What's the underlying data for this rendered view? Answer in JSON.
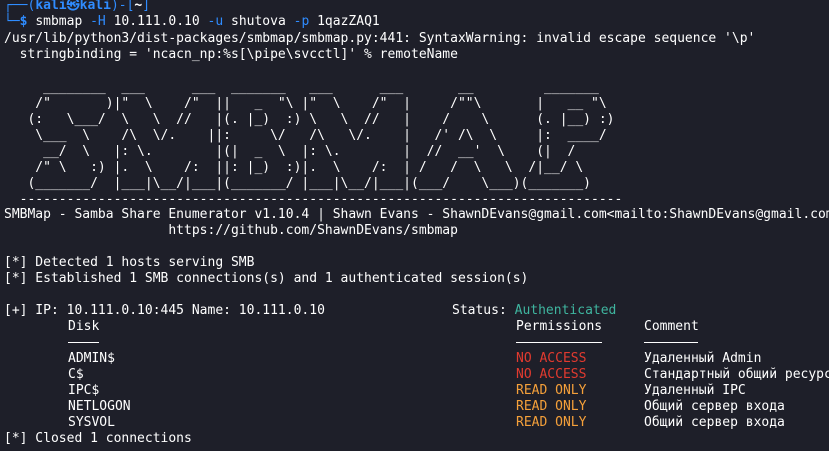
{
  "prompt": {
    "left_bracket_top": "┌──(",
    "user_host": "kali㉿kali",
    "mid": ")-[",
    "path": "~",
    "right": "]",
    "left_bracket_bottom": "└─",
    "dollar": "$ "
  },
  "command": {
    "program": "smbmap",
    "flag_h": " -H",
    "host": " 10.111.0.10",
    "flag_u": " -u",
    "user": " shutova",
    "flag_p": " -p",
    "pass": " 1qazZAQ1"
  },
  "warning": {
    "line1": "/usr/lib/python3/dist-packages/smbmap/smbmap.py:441: SyntaxWarning: invalid escape sequence '\\p'",
    "line2": "  stringbinding = 'ncacn_np:%s[\\pipe\\svcctl]' % remoteName"
  },
  "banner": {
    "art": "     ________  ___      ___  _______   ___      ___       __         _______\n    /\"       )|\"  \\    /\"  ||   _  \"\\ |\"  \\    /\"  |     /\"\"\\       |   __ \"\\\n   (:   \\___/  \\   \\  //   |(. |_)  :) \\   \\  //   |    /    \\      (. |__) :)\n    \\___  \\    /\\  \\/.    ||:     \\/   /\\   \\/.    |   /' /\\  \\     |:  ____/\n     __/  \\   |: \\.        |(|  _  \\  |: \\.        |  //  __'  \\    (|  /\n    /\" \\   :) |.  \\    /:  ||: |_)  :)|.  \\    /:  | /   /  \\   \\  /|__/ \\\n   (_______/  |___|\\__/|___|(_______/ |___|\\__/|___|(___/    \\___)(_______)\n  -----------------------------------------------------------------------------",
    "title_line": "SMBMap - Samba Share Enumerator v1.10.4 | Shawn Evans - ShawnDEvans@gmail.com<mailto:ShawnDEvans@gmail.com>",
    "url_line": "                     https://github.com/ShawnDEvans/smbmap"
  },
  "status_lines": {
    "detected": "[*] Detected 1 hosts serving SMB",
    "established": "[*] Established 1 SMB connections(s) and 1 authenticated session(s)"
  },
  "host": {
    "prefix": "[+] IP: 10.111.0.10:445 Name: 10.111.0.10",
    "status_label": "Status: ",
    "status_value": "Authenticated"
  },
  "table": {
    "headers": {
      "disk": "Disk",
      "permissions": "Permissions",
      "comment": "Comment"
    },
    "underlines": {
      "disk": "----",
      "permissions": "-----------",
      "comment": "-------"
    },
    "rows": [
      {
        "disk": "ADMIN$",
        "permissions": "NO ACCESS",
        "perm_color": "#e23a2f",
        "comment": "Удаленный Admin"
      },
      {
        "disk": "C$",
        "permissions": "NO ACCESS",
        "perm_color": "#e23a2f",
        "comment": "Стандартный общий ресурс"
      },
      {
        "disk": "IPC$",
        "permissions": "READ ONLY",
        "perm_color": "#f5a03a",
        "comment": "Удаленный IPC"
      },
      {
        "disk": "NETLOGON",
        "permissions": "READ ONLY",
        "perm_color": "#f5a03a",
        "comment": "Общий сервер входа"
      },
      {
        "disk": "SYSVOL",
        "permissions": "READ ONLY",
        "perm_color": "#f5a03a",
        "comment": "Общий сервер входа"
      }
    ]
  },
  "closed": "[*] Closed 1 connections",
  "colors": {
    "background": "#1e1f29",
    "prompt_blue": "#2f8cff",
    "authenticated_green": "#3fb59f",
    "no_access_red": "#e23a2f",
    "read_only_orange": "#f5a03a"
  }
}
